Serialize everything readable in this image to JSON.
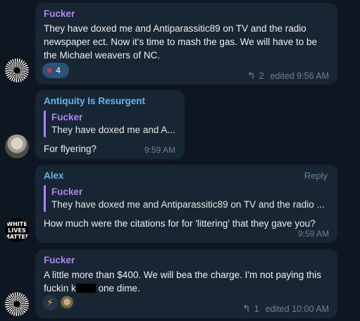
{
  "colors": {
    "background": "#0e1621",
    "bubble": "#182533",
    "sender_fucker": "#b085f5",
    "sender_antiquity": "#64b5ef",
    "sender_alex": "#64b5ef",
    "meta_text": "#6d8093",
    "reaction_bg": "#2b5278"
  },
  "messages": [
    {
      "sender": "Fucker",
      "lines": [
        "They have doxed me and Antiparassitic89 on TV and the radio",
        "newspaper ect. Now it's time to mash the gas. We will have to be",
        "the Michael weavers of NC."
      ],
      "reaction": {
        "icon": "heart-icon",
        "count": "4"
      },
      "replies": "2",
      "time": "edited 9:56 AM",
      "avatar": "sunburst"
    },
    {
      "sender": "Antiquity Is Resurgent",
      "quote": {
        "name": "Fucker",
        "text": "They have doxed me and A..."
      },
      "text": "For flyering?",
      "time": "9:59 AM",
      "avatar": "statue"
    },
    {
      "sender": "Alex",
      "reply_label": "Reply",
      "quote": {
        "name": "Fucker",
        "text": "They have doxed me and Antiparassitic89 on TV and the radio ..."
      },
      "text": "How much were the citations for for 'littering' that they gave you?",
      "time": "9:59 AM",
      "avatar": {
        "line1": "WHITE",
        "line2": "LIVES",
        "line3": "MATTER"
      }
    },
    {
      "sender": "Fucker",
      "line1": "A little more than $400. We will bea the charge. I'm not paying this",
      "line2_start": "fuckin k",
      "line2_end": " one dime.",
      "reactions": [
        "lightning-icon",
        "sticker-icon"
      ],
      "replies": "1",
      "time": "edited 10:00 AM",
      "avatar": "sunburst"
    }
  ]
}
